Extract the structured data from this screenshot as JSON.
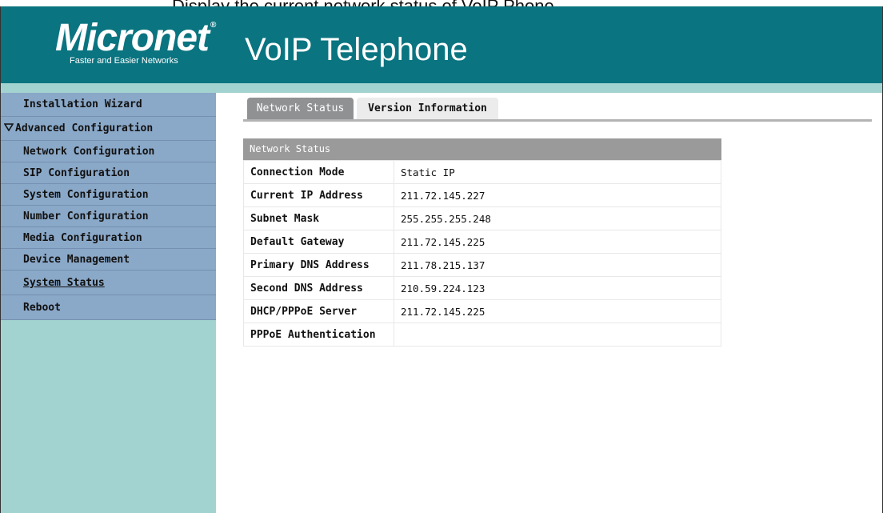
{
  "window_caption": "Display the current network status of VoIP Phone",
  "header": {
    "logo_text": "Micronet",
    "logo_registered": "®",
    "logo_tagline": "Faster and Easier Networks",
    "product_title": "VoIP Telephone"
  },
  "sidebar": {
    "items": [
      {
        "label": "Installation Wizard"
      },
      {
        "label": "Advanced Configuration",
        "expanded": true
      },
      {
        "label": "Network Configuration"
      },
      {
        "label": "SIP Configuration"
      },
      {
        "label": "System Configuration"
      },
      {
        "label": "Number Configuration"
      },
      {
        "label": "Media Configuration"
      },
      {
        "label": "Device Management"
      },
      {
        "label": "System Status",
        "active": true
      },
      {
        "label": "Reboot"
      }
    ]
  },
  "tabs": [
    {
      "label": "Network Status",
      "selected": true
    },
    {
      "label": "Version Information",
      "selected": false
    }
  ],
  "panel": {
    "title": "Network Status",
    "rows": [
      {
        "label": "Connection Mode",
        "value": "Static IP"
      },
      {
        "label": "Current IP Address",
        "value": "211.72.145.227"
      },
      {
        "label": "Subnet Mask",
        "value": "255.255.255.248"
      },
      {
        "label": "Default Gateway",
        "value": "211.72.145.225"
      },
      {
        "label": "Primary DNS Address",
        "value": "211.78.215.137"
      },
      {
        "label": "Second DNS Address",
        "value": "210.59.224.123"
      },
      {
        "label": "DHCP/PPPoE Server",
        "value": "211.72.145.225"
      },
      {
        "label": "PPPoE Authentication",
        "value": ""
      }
    ]
  },
  "colors": {
    "banner": "#0a7480",
    "sidebar_bg": "#a3d3d0",
    "nav_item_bg": "#8aa8c8",
    "selected_tab_bg": "#8f9193",
    "panel_header_bg": "#9a9a9a"
  }
}
